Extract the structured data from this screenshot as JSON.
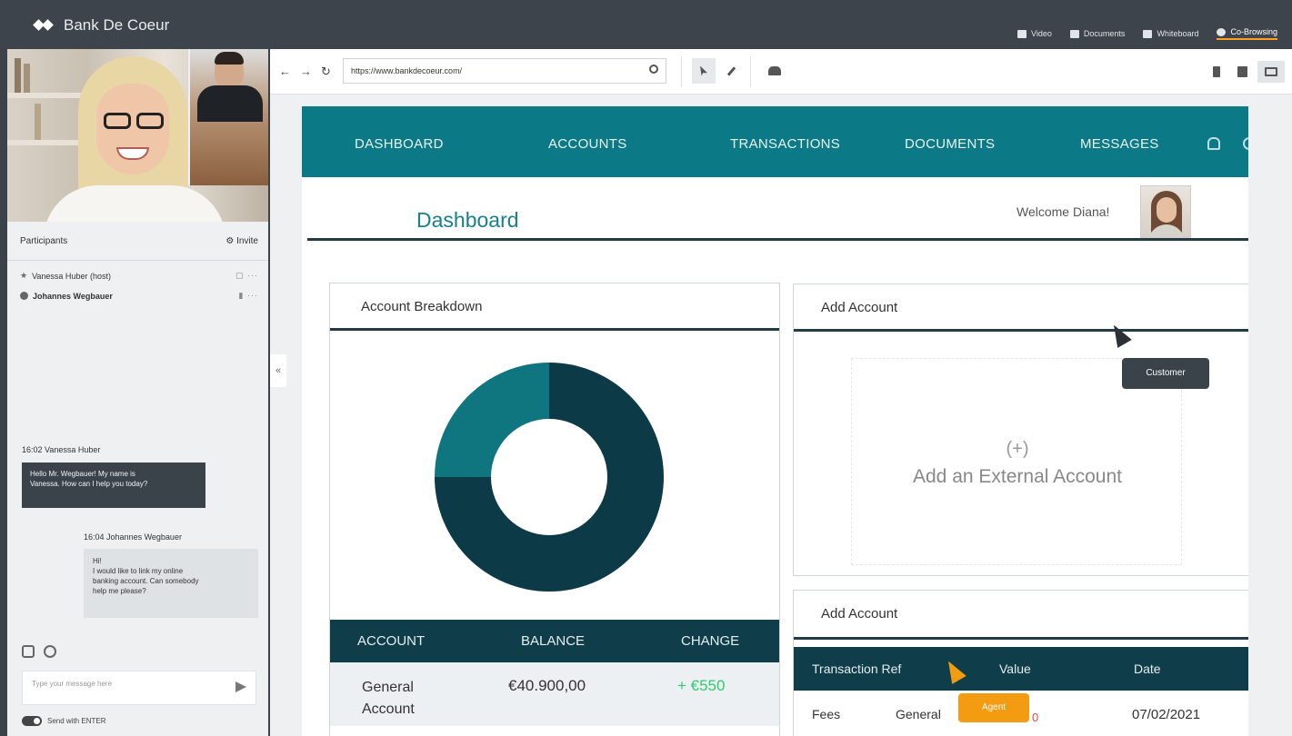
{
  "app": {
    "name": "Bank De Coeur"
  },
  "modes": [
    {
      "label": "Video",
      "active": false,
      "icon": "video-icon"
    },
    {
      "label": "Documents",
      "active": false,
      "icon": "document-icon"
    },
    {
      "label": "Whiteboard",
      "active": false,
      "icon": "whiteboard-icon"
    },
    {
      "label": "Co-Browsing",
      "active": true,
      "icon": "eye-icon"
    }
  ],
  "participants": {
    "title": "Participants",
    "invite_label": "Invite",
    "list": [
      {
        "name": "Vanessa Huber (host)"
      },
      {
        "name": "Johannes Wegbauer"
      }
    ]
  },
  "chat": {
    "messages": [
      {
        "time": "16:02",
        "author": "Vanessa Huber",
        "text": "Hello Mr. Wegbauer! My name is\nVanessa. How can I help you today?"
      },
      {
        "time": "16:04",
        "author": "Johannes Wegbauer",
        "text": "Hi!\nI would like to link my online\nbanking account. Can somebody\nhelp me please?"
      }
    ],
    "input_placeholder": "Type your message here",
    "send_on_enter": "Send with ENTER"
  },
  "browser": {
    "url": "https://www.bankdecoeur.com/",
    "collapse_label": "«"
  },
  "site": {
    "nav": [
      "DASHBOARD",
      "ACCOUNTS",
      "TRANSACTIONS",
      "DOCUMENTS",
      "MESSAGES"
    ],
    "welcome": "Welcome Diana!",
    "page_title": "Dashboard",
    "breakdown": {
      "title": "Account Breakdown",
      "columns": [
        "ACCOUNT",
        "BALANCE",
        "CHANGE"
      ],
      "rows": [
        {
          "account": "General Account",
          "balance": "€40.900,00",
          "change": "+ €550"
        }
      ],
      "chart_data": {
        "type": "pie",
        "donut": true,
        "categories": [
          "",
          ""
        ],
        "values": [
          75,
          25
        ],
        "colors": [
          "#0d3a47",
          "#0f7680"
        ]
      }
    },
    "add_account": {
      "title": "Add Account",
      "plus": "(+)",
      "text": "Add an External Account"
    },
    "transactions": {
      "title": "Add Account",
      "columns": [
        "Transaction Ref",
        "Value",
        "Date"
      ],
      "rows": [
        {
          "ref": "Fees",
          "account": "General",
          "value": "0",
          "date": "07/02/2021"
        }
      ]
    },
    "tooltips": {
      "customer": "Customer",
      "agent": "Agent"
    }
  },
  "colors": {
    "teal": "#0b7a86",
    "navy": "#0f3d4a",
    "positive": "#2ecc71",
    "negative": "#e74c3c",
    "agent": "#f39c12"
  }
}
